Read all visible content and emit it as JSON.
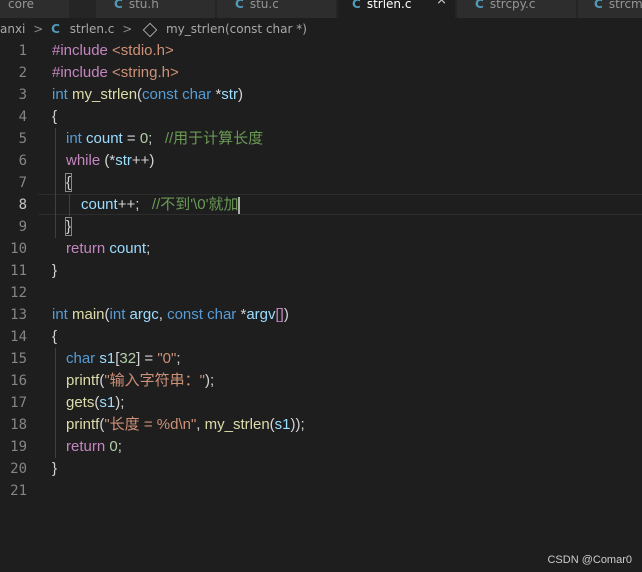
{
  "tabs": [
    {
      "icon": "",
      "label": "core",
      "active": false
    },
    {
      "icon": "C",
      "label": "stu.h",
      "active": false
    },
    {
      "icon": "C",
      "label": "stu.c",
      "active": false
    },
    {
      "icon": "C",
      "label": "strlen.c",
      "active": true,
      "close": "×"
    },
    {
      "icon": "C",
      "label": "strcpy.c",
      "active": false
    },
    {
      "icon": "C",
      "label": "strcm",
      "active": false
    }
  ],
  "breadcrumb": {
    "folder": "anxi",
    "sep": ">",
    "file_icon": "C",
    "file": "strlen.c",
    "symbol": "my_strlen(const char *)",
    "symbol_icon": "cube-icon"
  },
  "editor": {
    "active_line": 8,
    "lines": [
      {
        "n": "1"
      },
      {
        "n": "2"
      },
      {
        "n": "3"
      },
      {
        "n": "4"
      },
      {
        "n": "5"
      },
      {
        "n": "6"
      },
      {
        "n": "7"
      },
      {
        "n": "8"
      },
      {
        "n": "9"
      },
      {
        "n": "10"
      },
      {
        "n": "11"
      },
      {
        "n": "12"
      },
      {
        "n": "13"
      },
      {
        "n": "14"
      },
      {
        "n": "15"
      },
      {
        "n": "16"
      },
      {
        "n": "17"
      },
      {
        "n": "18"
      },
      {
        "n": "19"
      },
      {
        "n": "20"
      },
      {
        "n": "21"
      }
    ],
    "tokens": {
      "l1_a": "#include ",
      "l1_b": "<stdio.h>",
      "l2_a": "#include ",
      "l2_b": "<string.h>",
      "l3_a": "int ",
      "l3_b": "my_strlen",
      "l3_c": "(",
      "l3_d": "const ",
      "l3_e": "char ",
      "l3_f": "*",
      "l3_g": "str",
      "l3_h": ")",
      "l4": "{",
      "l5_a": "int ",
      "l5_b": "count",
      "l5_c": " = ",
      "l5_d": "0",
      "l5_e": ";   ",
      "l5_f": "//用于计算长度",
      "l6_a": "while ",
      "l6_b": "(*",
      "l6_c": "str",
      "l6_d": "++)",
      "l7": "{",
      "l8_a": "count",
      "l8_b": "++;   ",
      "l8_c": "//不到'\\0'就加",
      "l9": "}",
      "l10_a": "return ",
      "l10_b": "count",
      "l10_c": ";",
      "l11": "}",
      "l13_a": "int ",
      "l13_b": "main",
      "l13_c": "(",
      "l13_d": "int ",
      "l13_e": "argc",
      "l13_f": ", ",
      "l13_g": "const ",
      "l13_h": "char ",
      "l13_i": "*",
      "l13_j": "argv",
      "l13_k": "[]",
      "l13_l": ")",
      "l14": "{",
      "l15_a": "char ",
      "l15_b": "s1",
      "l15_c": "[",
      "l15_d": "32",
      "l15_e": "] = ",
      "l15_f": "\"0\"",
      "l15_g": ";",
      "l16_a": "printf",
      "l16_b": "(",
      "l16_c": "\"输入字符串：\"",
      "l16_d": ");",
      "l17_a": "gets",
      "l17_b": "(",
      "l17_c": "s1",
      "l17_d": ");",
      "l18_a": "printf",
      "l18_b": "(",
      "l18_c": "\"长度 = %d\\n\"",
      "l18_d": ", ",
      "l18_e": "my_strlen",
      "l18_f": "(",
      "l18_g": "s1",
      "l18_h": "));",
      "l19_a": "return ",
      "l19_b": "0",
      "l19_c": ";",
      "l20": "}"
    }
  },
  "watermark": "CSDN  @Comar0",
  "colors": {
    "background": "#1e1e1e",
    "keyword": "#569cd6",
    "control": "#c586c0",
    "function": "#dcdcaa",
    "variable": "#9cdcfe",
    "string": "#ce9178",
    "number": "#b5cea8",
    "comment": "#6a9955",
    "c_file_icon": "#519aba"
  }
}
